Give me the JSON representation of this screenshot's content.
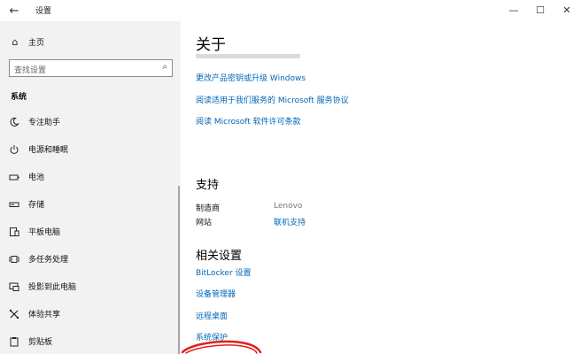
{
  "window": {
    "title": "设置",
    "back_icon": "←",
    "min_icon": "—",
    "max_icon": "☐",
    "close_icon": "✕"
  },
  "sidebar": {
    "home_label": "主页",
    "search_placeholder": "查找设置",
    "section_label": "系统",
    "items": [
      {
        "label": "专注助手",
        "icon": "moon-icon"
      },
      {
        "label": "电源和睡眠",
        "icon": "power-icon"
      },
      {
        "label": "电池",
        "icon": "battery-icon"
      },
      {
        "label": "存储",
        "icon": "storage-icon"
      },
      {
        "label": "平板电脑",
        "icon": "tablet-icon"
      },
      {
        "label": "多任务处理",
        "icon": "multitask-icon"
      },
      {
        "label": "投影到此电脑",
        "icon": "project-icon"
      },
      {
        "label": "体验共享",
        "icon": "share-icon"
      },
      {
        "label": "剪贴板",
        "icon": "clipboard-icon"
      }
    ]
  },
  "main": {
    "title": "关于",
    "links_top": [
      "更改产品密钥或升级 Windows",
      "阅读适用于我们服务的 Microsoft 服务协议",
      "阅读 Microsoft 软件许可条款"
    ],
    "support": {
      "heading": "支持",
      "rows": [
        {
          "key": "制造商",
          "value": "Lenovo"
        },
        {
          "key": "网站",
          "value": "联机支持"
        }
      ]
    },
    "related": {
      "heading": "相关设置",
      "links": [
        "BitLocker 设置",
        "设备管理器",
        "远程桌面",
        "系统保护"
      ]
    }
  },
  "colors": {
    "link": "#0067b8",
    "sidebar_bg": "#f2f2f2",
    "annotation": "#e0201a"
  }
}
